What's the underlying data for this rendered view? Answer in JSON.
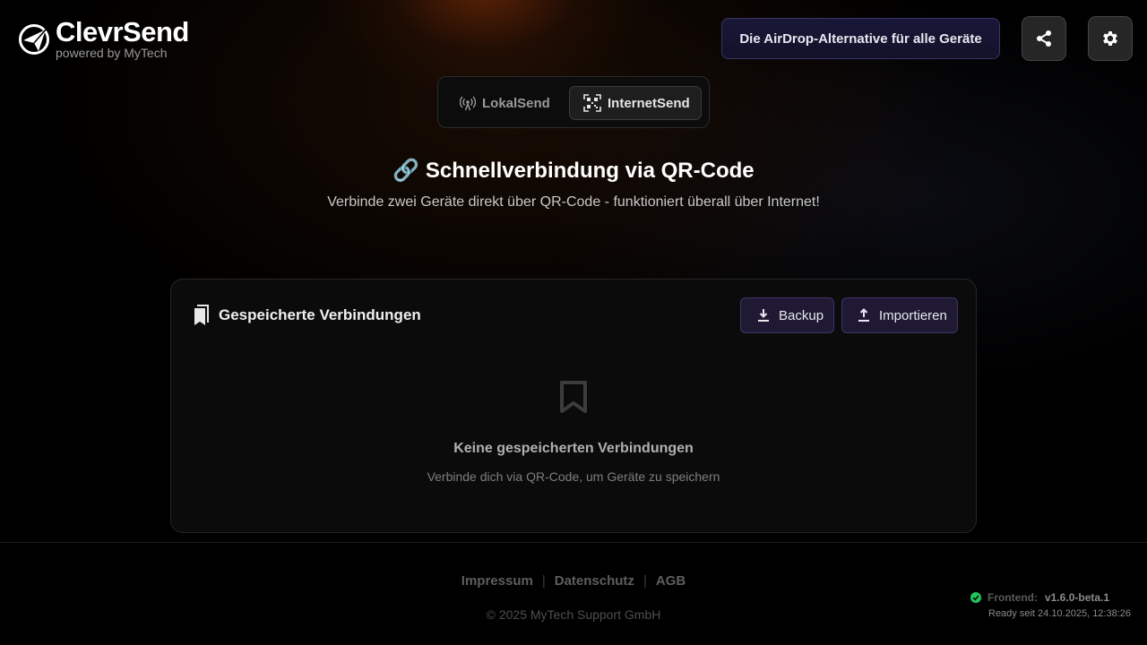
{
  "app": {
    "name": "ClevrSend",
    "subtitle": "powered by MyTech",
    "tagline": "Die AirDrop-Alternative für alle Geräte"
  },
  "header": {
    "share_icon": "share-icon",
    "settings_icon": "gear-icon"
  },
  "mode_switch": {
    "tabs": [
      {
        "label": "LokalSend",
        "icon": "broadcast-icon",
        "active": false
      },
      {
        "label": "InternetSend",
        "icon": "qr-code-icon",
        "active": true
      }
    ]
  },
  "main": {
    "title": "🔗 Schnellverbindung via QR-Code",
    "subtitle": "Verbinde zwei Geräte direkt über QR-Code - funktioniert überall über Internet!"
  },
  "saved": {
    "title": "Gespeicherte Verbindungen",
    "backup_label": "Backup",
    "import_label": "Importieren",
    "empty_title": "Keine gespeicherten Verbindungen",
    "empty_subtitle": "Verbinde dich via QR-Code, um Geräte zu speichern"
  },
  "footer": {
    "links": [
      "Impressum",
      "Datenschutz",
      "AGB"
    ],
    "copyright": "© 2025 MyTech Support GmbH"
  },
  "status": {
    "label": "Frontend:",
    "version": "v1.6.0-beta.1",
    "ready": "Ready seit 24.10.2025, 12:38:26",
    "color": "#22c55e"
  },
  "colors": {
    "accent_button_bg": "#1f1934",
    "accent_button_border": "#3d3468",
    "background": "#000000"
  }
}
